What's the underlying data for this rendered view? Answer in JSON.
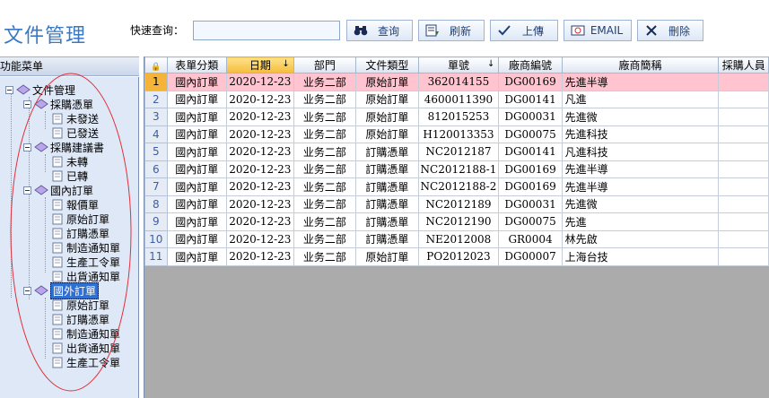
{
  "header": {
    "title": "文件管理",
    "search_label": "快速查询：",
    "search_value": "",
    "buttons": {
      "query": "查询",
      "refresh": "刷新",
      "upload": "上傳",
      "email": "EMAIL",
      "delete": "刪除"
    }
  },
  "sidebar": {
    "title": "功能菜单",
    "tree": {
      "root": "文件管理",
      "purchase_order": "採購憑單",
      "po_unsent": "未發送",
      "po_sent": "已發送",
      "purchase_suggestion": "採購建議書",
      "ps_untransferred": "未轉",
      "ps_transferred": "已轉",
      "domestic_order": "國內訂單",
      "do_quote": "報價單",
      "do_original": "原始訂單",
      "do_purchase": "訂購憑單",
      "do_manufacture": "制造通知單",
      "do_production": "生產工令單",
      "do_shipment": "出貨通知單",
      "foreign_order": "國外訂單",
      "fo_original": "原始訂單",
      "fo_purchase": "訂購憑單",
      "fo_manufacture": "制造通知單",
      "fo_shipment": "出貨通知單",
      "fo_production": "生產工令單"
    }
  },
  "grid": {
    "columns": {
      "form_type": "表單分類",
      "date": "日期",
      "department": "部門",
      "doc_type": "文件類型",
      "doc_no": "單號",
      "vendor_code": "廠商編號",
      "vendor_name": "廠商簡稱",
      "purchaser": "採購人員"
    },
    "rows": [
      {
        "n": "1",
        "form_type": "國內訂單",
        "date": "2020-12-23",
        "department": "业务二部",
        "doc_type": "原始訂單",
        "doc_no": "362014155",
        "vendor_code": "DG00169",
        "vendor_name": "先進半導"
      },
      {
        "n": "2",
        "form_type": "國內訂單",
        "date": "2020-12-23",
        "department": "业务二部",
        "doc_type": "原始訂單",
        "doc_no": "4600011390",
        "vendor_code": "DG00141",
        "vendor_name": "凡進"
      },
      {
        "n": "3",
        "form_type": "國內訂單",
        "date": "2020-12-23",
        "department": "业务二部",
        "doc_type": "原始訂單",
        "doc_no": "812015253",
        "vendor_code": "DG00031",
        "vendor_name": "先進微"
      },
      {
        "n": "4",
        "form_type": "國內訂單",
        "date": "2020-12-23",
        "department": "业务二部",
        "doc_type": "原始訂單",
        "doc_no": "H120013353",
        "vendor_code": "DG00075",
        "vendor_name": "先進科技"
      },
      {
        "n": "5",
        "form_type": "國內訂單",
        "date": "2020-12-23",
        "department": "业务二部",
        "doc_type": "訂購憑單",
        "doc_no": "NC2012187",
        "vendor_code": "DG00141",
        "vendor_name": "凡進科技"
      },
      {
        "n": "6",
        "form_type": "國內訂單",
        "date": "2020-12-23",
        "department": "业务二部",
        "doc_type": "訂購憑單",
        "doc_no": "NC2012188-1",
        "vendor_code": "DG00169",
        "vendor_name": "先進半導"
      },
      {
        "n": "7",
        "form_type": "國內訂單",
        "date": "2020-12-23",
        "department": "业务二部",
        "doc_type": "訂購憑單",
        "doc_no": "NC2012188-2",
        "vendor_code": "DG00169",
        "vendor_name": "先進半導"
      },
      {
        "n": "8",
        "form_type": "國內訂單",
        "date": "2020-12-23",
        "department": "业务二部",
        "doc_type": "訂購憑單",
        "doc_no": "NC2012189",
        "vendor_code": "DG00031",
        "vendor_name": "先進微"
      },
      {
        "n": "9",
        "form_type": "國內訂單",
        "date": "2020-12-23",
        "department": "业务二部",
        "doc_type": "訂購憑單",
        "doc_no": "NC2012190",
        "vendor_code": "DG00075",
        "vendor_name": "先進"
      },
      {
        "n": "10",
        "form_type": "國內訂單",
        "date": "2020-12-23",
        "department": "业务二部",
        "doc_type": "訂購憑單",
        "doc_no": "NE2012008",
        "vendor_code": "GR0004",
        "vendor_name": "林先啟"
      },
      {
        "n": "11",
        "form_type": "國內訂單",
        "date": "2020-12-23",
        "department": "业务二部",
        "doc_type": "原始訂單",
        "doc_no": "PO2012023",
        "vendor_code": "DG00007",
        "vendor_name": "上海台技"
      }
    ]
  },
  "colors": {
    "title_blue": "#3a78c3",
    "selected_row": "#ffc4cf",
    "sorted_header": "#f3bd3b",
    "annotation_oval": "#e0303a"
  }
}
